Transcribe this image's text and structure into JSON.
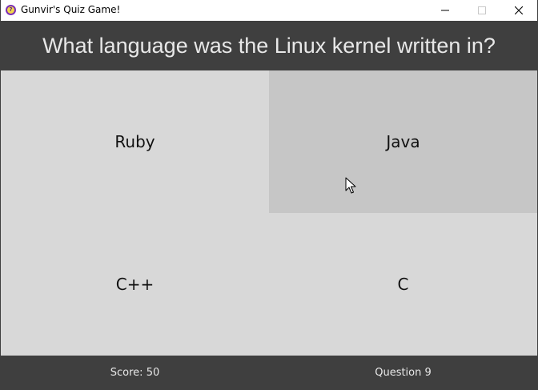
{
  "window": {
    "title": "Gunvir's Quiz Game!",
    "app_icon": "question-mark-icon"
  },
  "question": {
    "text": "What language was the Linux kernel written in?"
  },
  "answers": [
    {
      "label": "Ruby"
    },
    {
      "label": "Java"
    },
    {
      "label": "C++"
    },
    {
      "label": "C"
    }
  ],
  "footer": {
    "score_text": "Score: 50",
    "question_text": "Question 9"
  },
  "colors": {
    "header_bg": "#3f3f3f",
    "header_text": "#e8e8e8",
    "answer_bg": "#d8d8d8",
    "answer_hover_bg": "#c6c6c6"
  }
}
